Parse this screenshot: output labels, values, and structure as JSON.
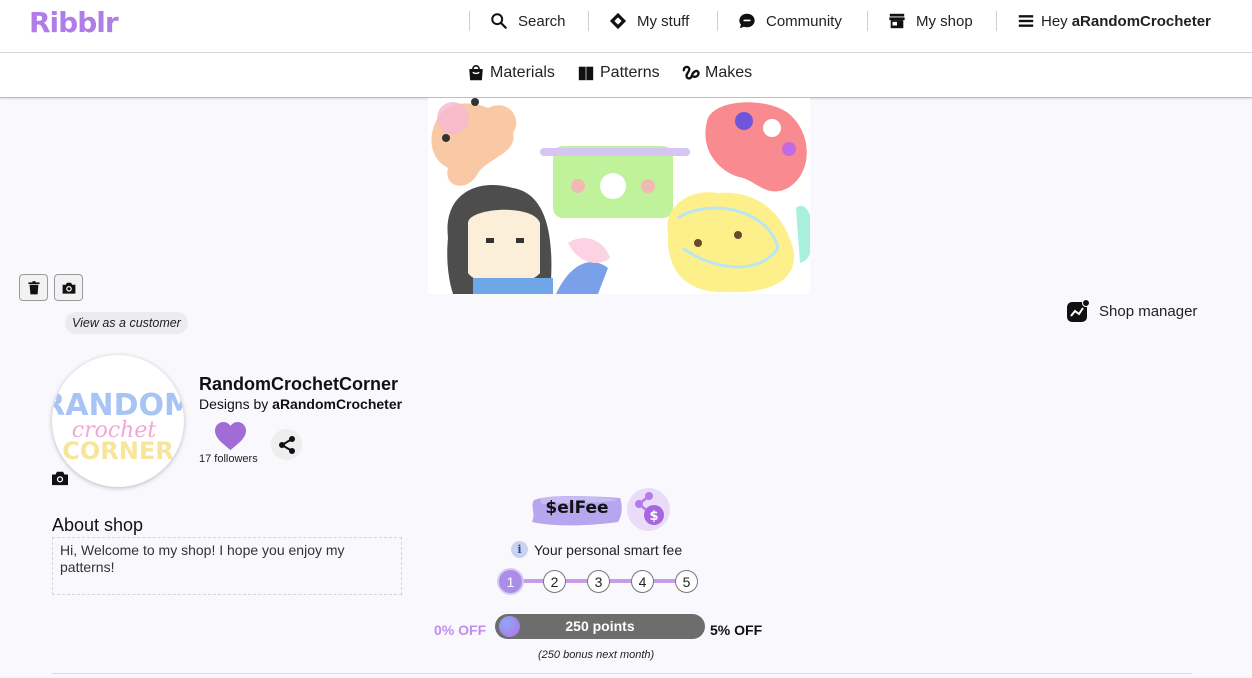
{
  "app": {
    "logo": "Ribblr"
  },
  "topnav": {
    "search": "Search",
    "my_stuff": "My stuff",
    "community": "Community",
    "my_shop": "My shop",
    "greeting_prefix": "Hey",
    "username": "aRandomCrocheter"
  },
  "subnav": {
    "materials": "Materials",
    "patterns": "Patterns",
    "makes": "Makes"
  },
  "shop": {
    "view_as_customer": "View as a customer",
    "shop_manager": "Shop manager",
    "name": "RandomCrochetCorner",
    "designs_by_prefix": "Designs by",
    "designer": "aRandomCrocheter",
    "followers": "17 followers",
    "logo_text": [
      "RANDOM",
      "crochet",
      "CORNER"
    ],
    "about_title": "About shop",
    "about_text": "Hi, Welcome to my shop! I hope you enjoy my patterns!"
  },
  "selfee": {
    "logo": "$elFee",
    "caption": "Your personal smart fee",
    "info_icon_glyph": "i",
    "steps": [
      "1",
      "2",
      "3",
      "4",
      "5"
    ],
    "active_step": 1,
    "min_label": "0% OFF",
    "max_label": "5% OFF",
    "points": "250 points",
    "progress_fraction": 0.0,
    "bonus_note": "(250 bonus next month)"
  },
  "icons": {
    "search": "search-icon",
    "my_stuff": "diamond-icon",
    "community": "chat-bubble-icon",
    "my_shop": "store-icon",
    "menu": "hamburger-icon",
    "materials": "bag-icon",
    "patterns": "book-icon",
    "makes": "yarn-loop-icon",
    "delete": "trash-icon",
    "camera": "camera-icon",
    "shop_manager": "chart-icon",
    "heart": "heart-icon",
    "share": "share-icon"
  },
  "colors": {
    "brand": "#b07de8",
    "heart": "#a06cd5",
    "step_active": "#a98ee8",
    "discount_min": "#c18df0"
  }
}
